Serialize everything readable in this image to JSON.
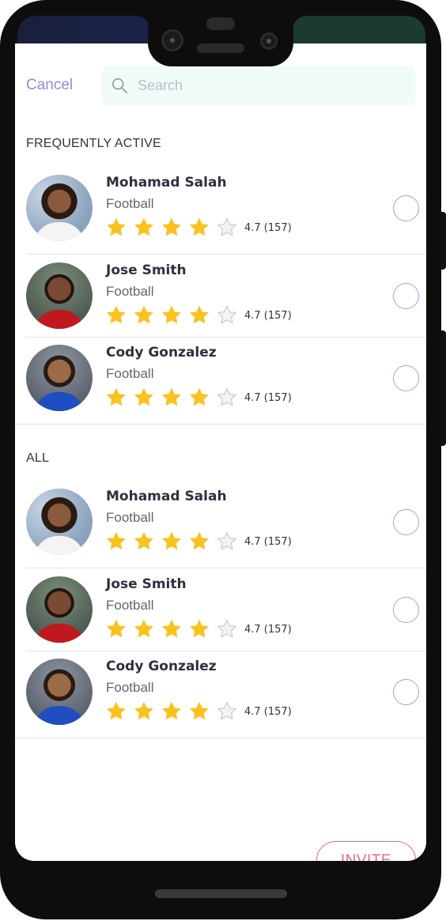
{
  "header": {
    "cancel_label": "Cancel",
    "search_placeholder": "Search"
  },
  "sections": [
    {
      "title": "FREQUENTLY ACTIVE",
      "players": [
        {
          "name": "Mohamad Salah",
          "sport": "Football",
          "stars": 4,
          "max_stars": 5,
          "rating": "4.7 (157)",
          "selected": false
        },
        {
          "name": "Jose Smith",
          "sport": "Football",
          "stars": 4,
          "max_stars": 5,
          "rating": "4.7 (157)",
          "selected": false
        },
        {
          "name": "Cody Gonzalez",
          "sport": "Football",
          "stars": 4,
          "max_stars": 5,
          "rating": "4.7 (157)",
          "selected": false
        }
      ]
    },
    {
      "title": "ALL",
      "players": [
        {
          "name": "Mohamad Salah",
          "sport": "Football",
          "stars": 4,
          "max_stars": 5,
          "rating": "4.7 (157)",
          "selected": false
        },
        {
          "name": "Jose Smith",
          "sport": "Football",
          "stars": 4,
          "max_stars": 5,
          "rating": "4.7 (157)",
          "selected": false
        },
        {
          "name": "Cody Gonzalez",
          "sport": "Football",
          "stars": 4,
          "max_stars": 5,
          "rating": "4.7 (157)",
          "selected": false
        }
      ]
    }
  ],
  "footer": {
    "invite_label": "INVITE"
  },
  "colors": {
    "accent": "#8c8ed6",
    "star_filled": "#f9c21e",
    "star_empty": "#f2f2f7",
    "invite": "#e06a8e",
    "search_bg": "#f1fcf9"
  }
}
